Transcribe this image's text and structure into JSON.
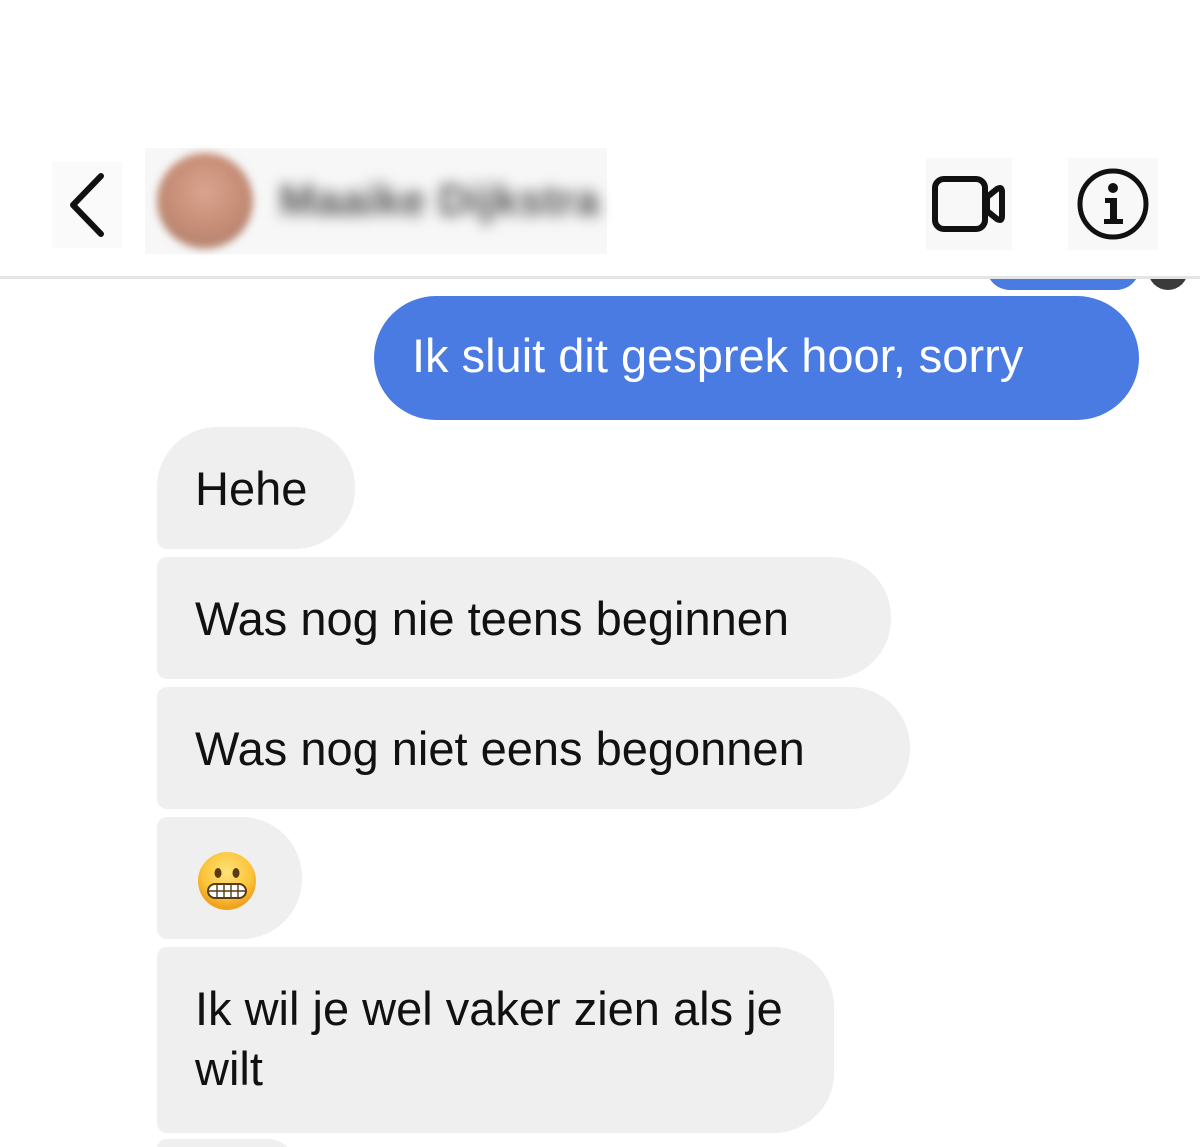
{
  "header": {
    "back_label": "Back",
    "contact_name": "Maaike Dijkstra",
    "video_icon": "video-camera-icon",
    "info_icon": "info-icon"
  },
  "colors": {
    "outgoing_bubble": "#4a7be2",
    "incoming_bubble": "#efefef",
    "outgoing_text": "#ffffff",
    "incoming_text": "#111111"
  },
  "messages": [
    {
      "direction": "outgoing",
      "text": "Ik sluit dit gesprek hoor, sorry"
    },
    {
      "direction": "incoming",
      "text": "Hehe"
    },
    {
      "direction": "incoming",
      "text": "Was nog nie teens beginnen"
    },
    {
      "direction": "incoming",
      "text": "Was nog niet eens begonnen"
    },
    {
      "direction": "incoming",
      "emoji": "grimacing-face-emoji"
    },
    {
      "direction": "incoming",
      "text": "Ik wil je wel vaker zien als je wilt"
    }
  ]
}
